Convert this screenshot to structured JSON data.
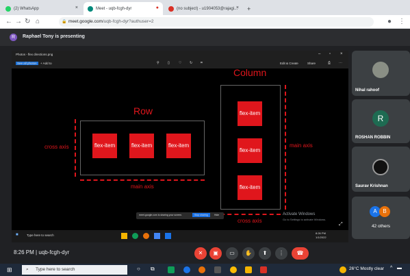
{
  "browser": {
    "tabs": [
      {
        "label": "(2) WhatsApp"
      },
      {
        "label": "Meet - uqb-fcgh-dyr"
      },
      {
        "label": "(no subject) - u1904053@rajagi..."
      }
    ],
    "new_tab": "+",
    "url_domain": "meet.google.com",
    "url_path": "/uqb-fcgh-dyr?authuser=2"
  },
  "presenting": {
    "avatar_letter": "R",
    "text": "Raphael Tony is presenting"
  },
  "shared_screen": {
    "window_title": "Photos - flex directions.png",
    "toolbar_left": [
      "See all photos",
      "+ Add to"
    ],
    "toolbar_right": [
      "Edit & Create",
      "Share"
    ],
    "diagram": {
      "row_title": "Row",
      "column_title": "Column",
      "row_items": [
        "flex-item",
        "flex-item",
        "flex-item"
      ],
      "column_items": [
        "flex-item",
        "flex-item",
        "flex-item"
      ],
      "row_cross_axis": "cross axis",
      "row_main_axis": "main axis",
      "col_main_axis": "main axis",
      "col_cross_axis": "cross axis"
    },
    "share_notice": "meet.google.com is sharing your screen.",
    "stop_sharing": "Stop sharing",
    "hide": "Hide",
    "activate_title": "Activate Windows",
    "activate_sub": "Go to Settings to activate Windows.",
    "inner_search": "Type here to search",
    "inner_time": "8:26 PM",
    "inner_date": "1/1/2022"
  },
  "participants": [
    {
      "name": "Nihal rahoof"
    },
    {
      "name": "ROSHAN ROBBIN",
      "letter": "R",
      "color": "#1e6b52"
    },
    {
      "name": "Saurav Krishnan"
    },
    {
      "name": "42 others",
      "letters": [
        "A",
        "B"
      ]
    }
  ],
  "meeting": {
    "time_code": "8:26 PM  |  uqb-fcgh-dyr"
  },
  "taskbar": {
    "search_placeholder": "Type here to search",
    "weather": "26°C  Mostly clear"
  },
  "colors": {
    "accent_red": "#e0161c",
    "presenter_purple": "#7e57c2",
    "end_call": "#ea4335"
  }
}
